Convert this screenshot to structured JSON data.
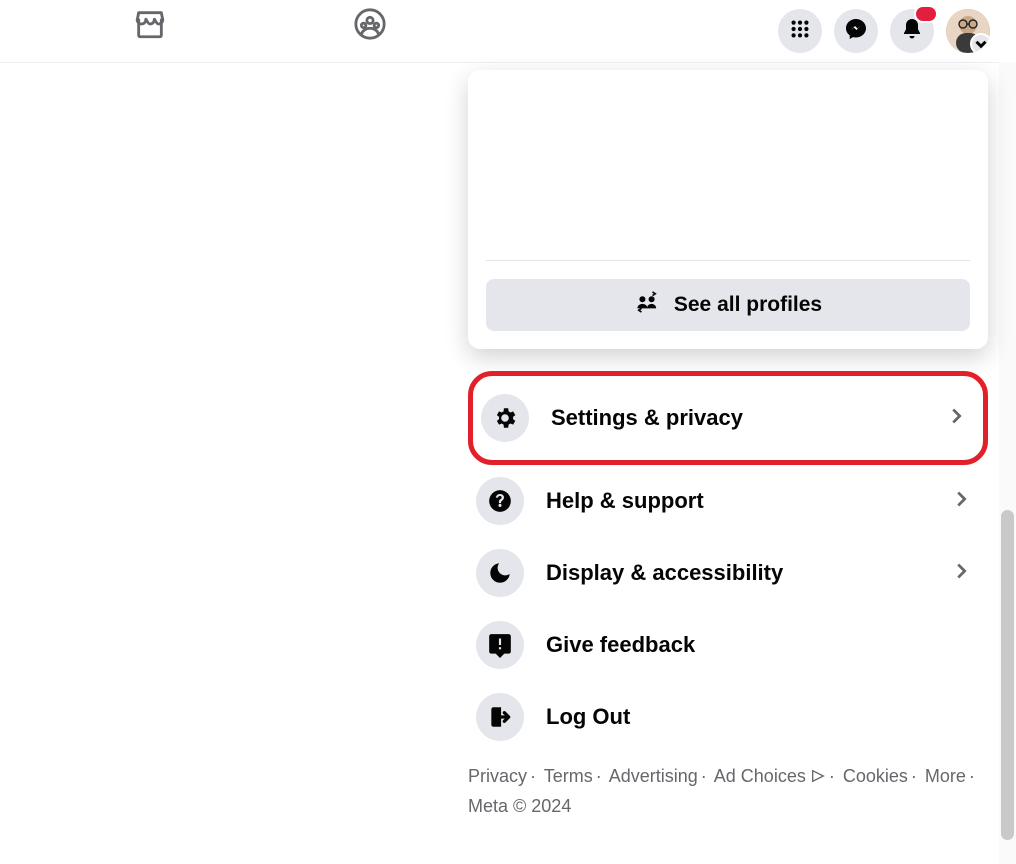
{
  "profileCard": {
    "seeAllProfiles": "See all profiles"
  },
  "menu": {
    "items": [
      {
        "icon": "gear-icon",
        "label": "Settings & privacy",
        "hasSubmenu": true,
        "highlighted": true
      },
      {
        "icon": "help-icon",
        "label": "Help & support",
        "hasSubmenu": true,
        "highlighted": false
      },
      {
        "icon": "moon-icon",
        "label": "Display & accessibility",
        "hasSubmenu": true,
        "highlighted": false
      },
      {
        "icon": "feedback-icon",
        "label": "Give feedback",
        "hasSubmenu": false,
        "highlighted": false
      },
      {
        "icon": "logout-icon",
        "label": "Log Out",
        "hasSubmenu": false,
        "highlighted": false
      }
    ]
  },
  "footer": {
    "links": [
      "Privacy",
      "Terms",
      "Advertising",
      "Ad Choices",
      "Cookies",
      "More"
    ],
    "copyright": "Meta © 2024"
  },
  "topbar": {
    "centerTabs": [
      "marketplace",
      "groups"
    ],
    "rightButtons": [
      "menu",
      "messenger",
      "notifications",
      "account"
    ],
    "notificationHasBadge": true
  },
  "colors": {
    "textPrimary": "#050505",
    "textSecondary": "#65676b",
    "surface": "#ffffff",
    "control": "#e4e6eb",
    "badge": "#e41e3f",
    "highlightRing": "#e2202a"
  }
}
